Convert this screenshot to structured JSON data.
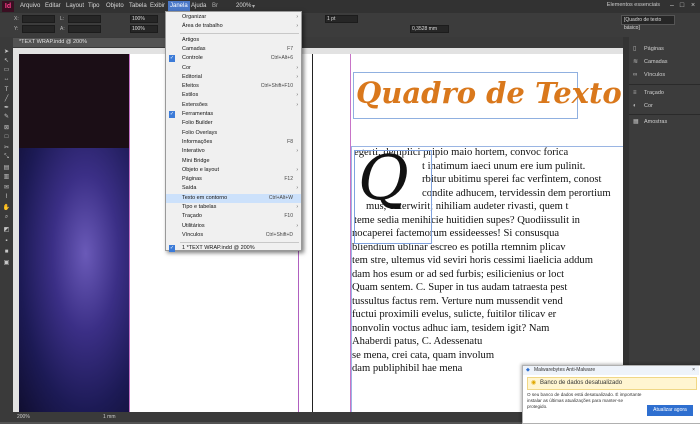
{
  "menubar": {
    "logo": "Id",
    "items": [
      "Arquivo",
      "Editar",
      "Layout",
      "Tipo",
      "Objeto",
      "Tabela",
      "Exibir",
      "Janela",
      "Ajuda"
    ],
    "zoom": "200%",
    "workspace": "Elementos essenciais"
  },
  "control": {
    "x_label": "X:",
    "y_label": "Y:",
    "w_label": "L:",
    "h_label": "A:",
    "x_value": "",
    "stroke_weight": "1 pt",
    "percent_w": "100%",
    "percent_h": "100%",
    "frame_style": "[Quadro de texto básico]",
    "style_value": "0,3528 mm"
  },
  "document": {
    "tab_label": "*TEXT WRAP.indd @ 200%",
    "title_text": "Quadro de Texto",
    "drop_cap": "Q",
    "body_lines": [
      "egerti, demplici pripio maio hortem, convoc forica",
      "t inatimum iaeci unum ere ium pulinit.",
      "rbitur ubitimu sperei fac verfintem, conost",
      "condite adhucem, tervidessin dem perortium",
      "mus, cuterwirit; nihiliam audeter rivasti, quem t",
      "teme sedia menihicie huitidien supes? Quodiissulit in",
      "nocaperei factemorum essideesses! Si consusqua",
      "bliendium ublinar escreo es potilla rtemnim plicav",
      "tem stre, ultemus vid seviri horis cessimi liaelicia addum",
      "dam hos esum or ad sed furbis; esilicienius or loct",
      "Quam sentem. C. Super in tus audam tatraesta pest",
      "tussultus factus rem. Verture num mussendit vend",
      "fuctui proximili evelus, sulicte, fuitilor tilicav er",
      "nonvolin voctus adhuc iam, tesidem igit? Nam",
      "Ahaberdi patus, C. Adessenatu",
      "se mena, crei cata, quam involum",
      "dam publiphibil hae mena"
    ],
    "zoom_status": "200%",
    "status_text": "1 mm"
  },
  "menu": {
    "items": [
      {
        "label": "Organizar",
        "shortcut": "",
        "arrow": true,
        "check": false,
        "highlight": false
      },
      {
        "label": "Área de trabalho",
        "shortcut": "",
        "arrow": true,
        "check": false,
        "highlight": false
      },
      {
        "divider": true
      },
      {
        "label": "Artigos",
        "shortcut": "",
        "arrow": false,
        "check": false,
        "highlight": false
      },
      {
        "label": "Camadas",
        "shortcut": "F7",
        "arrow": false,
        "check": false,
        "highlight": false
      },
      {
        "label": "Controle",
        "shortcut": "Ctrl+Alt+6",
        "arrow": false,
        "check": true,
        "highlight": false
      },
      {
        "label": "Cor",
        "shortcut": "",
        "arrow": true,
        "check": false,
        "highlight": false
      },
      {
        "label": "Editorial",
        "shortcut": "",
        "arrow": true,
        "check": false,
        "highlight": false
      },
      {
        "label": "Efeitos",
        "shortcut": "Ctrl+Shift+F10",
        "arrow": false,
        "check": false,
        "highlight": false
      },
      {
        "label": "Estilos",
        "shortcut": "",
        "arrow": true,
        "check": false,
        "highlight": false
      },
      {
        "label": "Extensões",
        "shortcut": "",
        "arrow": true,
        "check": false,
        "highlight": false
      },
      {
        "label": "Ferramentas",
        "shortcut": "",
        "arrow": false,
        "check": true,
        "highlight": false
      },
      {
        "label": "Folio Builder",
        "shortcut": "",
        "arrow": false,
        "check": false,
        "highlight": false
      },
      {
        "label": "Folio Overlays",
        "shortcut": "",
        "arrow": false,
        "check": false,
        "highlight": false
      },
      {
        "label": "Informações",
        "shortcut": "F8",
        "arrow": false,
        "check": false,
        "highlight": false
      },
      {
        "label": "Interativo",
        "shortcut": "",
        "arrow": true,
        "check": false,
        "highlight": false
      },
      {
        "label": "Mini Bridge",
        "shortcut": "",
        "arrow": false,
        "check": false,
        "highlight": false
      },
      {
        "label": "Objeto e layout",
        "shortcut": "",
        "arrow": true,
        "check": false,
        "highlight": false
      },
      {
        "label": "Páginas",
        "shortcut": "F12",
        "arrow": false,
        "check": false,
        "highlight": false
      },
      {
        "label": "Saída",
        "shortcut": "",
        "arrow": true,
        "check": false,
        "highlight": false
      },
      {
        "label": "Texto em contorno",
        "shortcut": "Ctrl+Alt+W",
        "arrow": false,
        "check": false,
        "highlight": true
      },
      {
        "label": "Tipo e tabelas",
        "shortcut": "",
        "arrow": true,
        "check": false,
        "highlight": false
      },
      {
        "label": "Traçado",
        "shortcut": "F10",
        "arrow": false,
        "check": false,
        "highlight": false
      },
      {
        "label": "Utilitários",
        "shortcut": "",
        "arrow": true,
        "check": false,
        "highlight": false
      },
      {
        "label": "Vínculos",
        "shortcut": "Ctrl+Shift+D",
        "arrow": false,
        "check": false,
        "highlight": false
      },
      {
        "divider": true
      },
      {
        "label": "1 *TEXT WRAP.indd @ 200%",
        "shortcut": "",
        "arrow": false,
        "check": true,
        "highlight": false
      }
    ]
  },
  "panels": {
    "group1": [
      "Páginas",
      "Camadas",
      "Vínculos"
    ],
    "group2": [
      "Traçado",
      "Cor"
    ],
    "group3": [
      "Amostras"
    ]
  },
  "notification": {
    "app": "Malwarebytes Anti-Malware",
    "title": "Banco de dados desatualizado",
    "body": "O seu banco de dados está desatualizado. É importante instalar as últimas atualizações para manter-se protegido.",
    "button": "Atualizar agora"
  }
}
